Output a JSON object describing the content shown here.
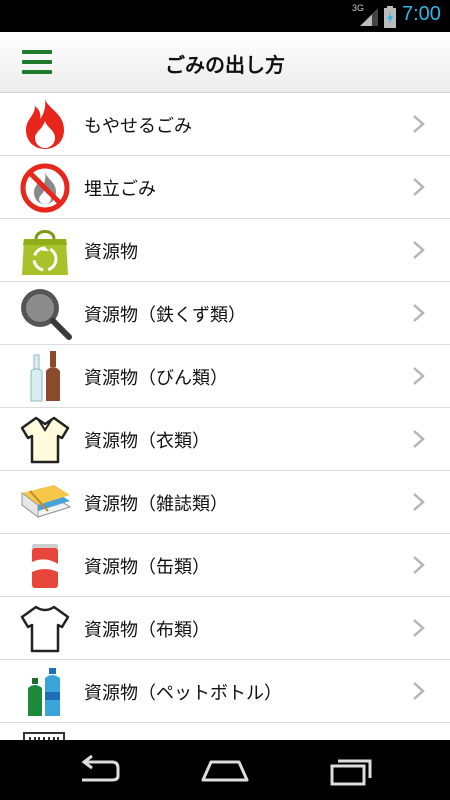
{
  "status_bar": {
    "network": "3G",
    "time": "7:00"
  },
  "app_bar": {
    "title": "ごみの出し方"
  },
  "categories": [
    {
      "label": "もやせるごみ",
      "icon": "burnable-fire-icon"
    },
    {
      "label": "埋立ごみ",
      "icon": "landfill-no-fire-icon"
    },
    {
      "label": "資源物",
      "icon": "recycle-bag-icon"
    },
    {
      "label": "資源物（鉄くず類）",
      "icon": "frying-pan-icon"
    },
    {
      "label": "資源物（びん類）",
      "icon": "bottles-icon"
    },
    {
      "label": "資源物（衣類）",
      "icon": "polo-shirt-icon"
    },
    {
      "label": "資源物（雑誌類）",
      "icon": "magazines-icon"
    },
    {
      "label": "資源物（缶類）",
      "icon": "can-icon"
    },
    {
      "label": "資源物（布類）",
      "icon": "t-shirt-icon"
    },
    {
      "label": "資源物（ペットボトル）",
      "icon": "pet-bottles-icon"
    }
  ],
  "colors": {
    "accent_green": "#1e7a2a",
    "fire_red": "#e8261c",
    "clock_blue": "#33b5e5"
  }
}
